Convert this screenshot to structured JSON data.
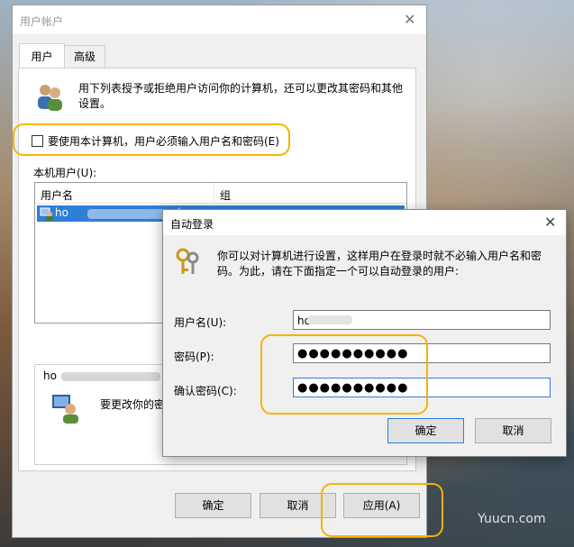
{
  "main_dialog": {
    "title": "用户帐户",
    "close_glyph": "✕",
    "tabs": [
      {
        "label": "用户"
      },
      {
        "label": "高级"
      }
    ],
    "description": "用下列表授予或拒绝用户访问你的计算机，还可以更改其密码和其他设置。",
    "checkbox_label": "要使用本计算机，用户必须输入用户名和密码(E)",
    "checkbox_checked": false,
    "local_users_label": "本机用户(U):",
    "table": {
      "headers": [
        "用户名",
        "组"
      ],
      "rows": [
        {
          "username_visible": "ho",
          "username_suffix": "loo"
        }
      ]
    },
    "user_section_prefix": "ho",
    "user_section_suffix": ".c",
    "change_password_text": "要更改你的密码",
    "buttons": {
      "ok": "确定",
      "cancel": "取消",
      "apply": "应用(A)"
    }
  },
  "auto_login_dialog": {
    "title": "自动登录",
    "close_glyph": "✕",
    "description": "你可以对计算机进行设置，这样用户在登录时就不必输入用户名和密码。为此，请在下面指定一个可以自动登录的用户:",
    "fields": {
      "username_label": "用户名(U):",
      "username_value": "ho",
      "password_label": "密码(P):",
      "password_value": "●●●●●●●●●●",
      "confirm_label": "确认密码(C):",
      "confirm_value": "●●●●●●●●●●"
    },
    "buttons": {
      "ok": "确定",
      "cancel": "取消"
    }
  },
  "highlight_color": "#f4b400",
  "selection_color": "#2f7ed8",
  "watermark": "Yuucn.com"
}
